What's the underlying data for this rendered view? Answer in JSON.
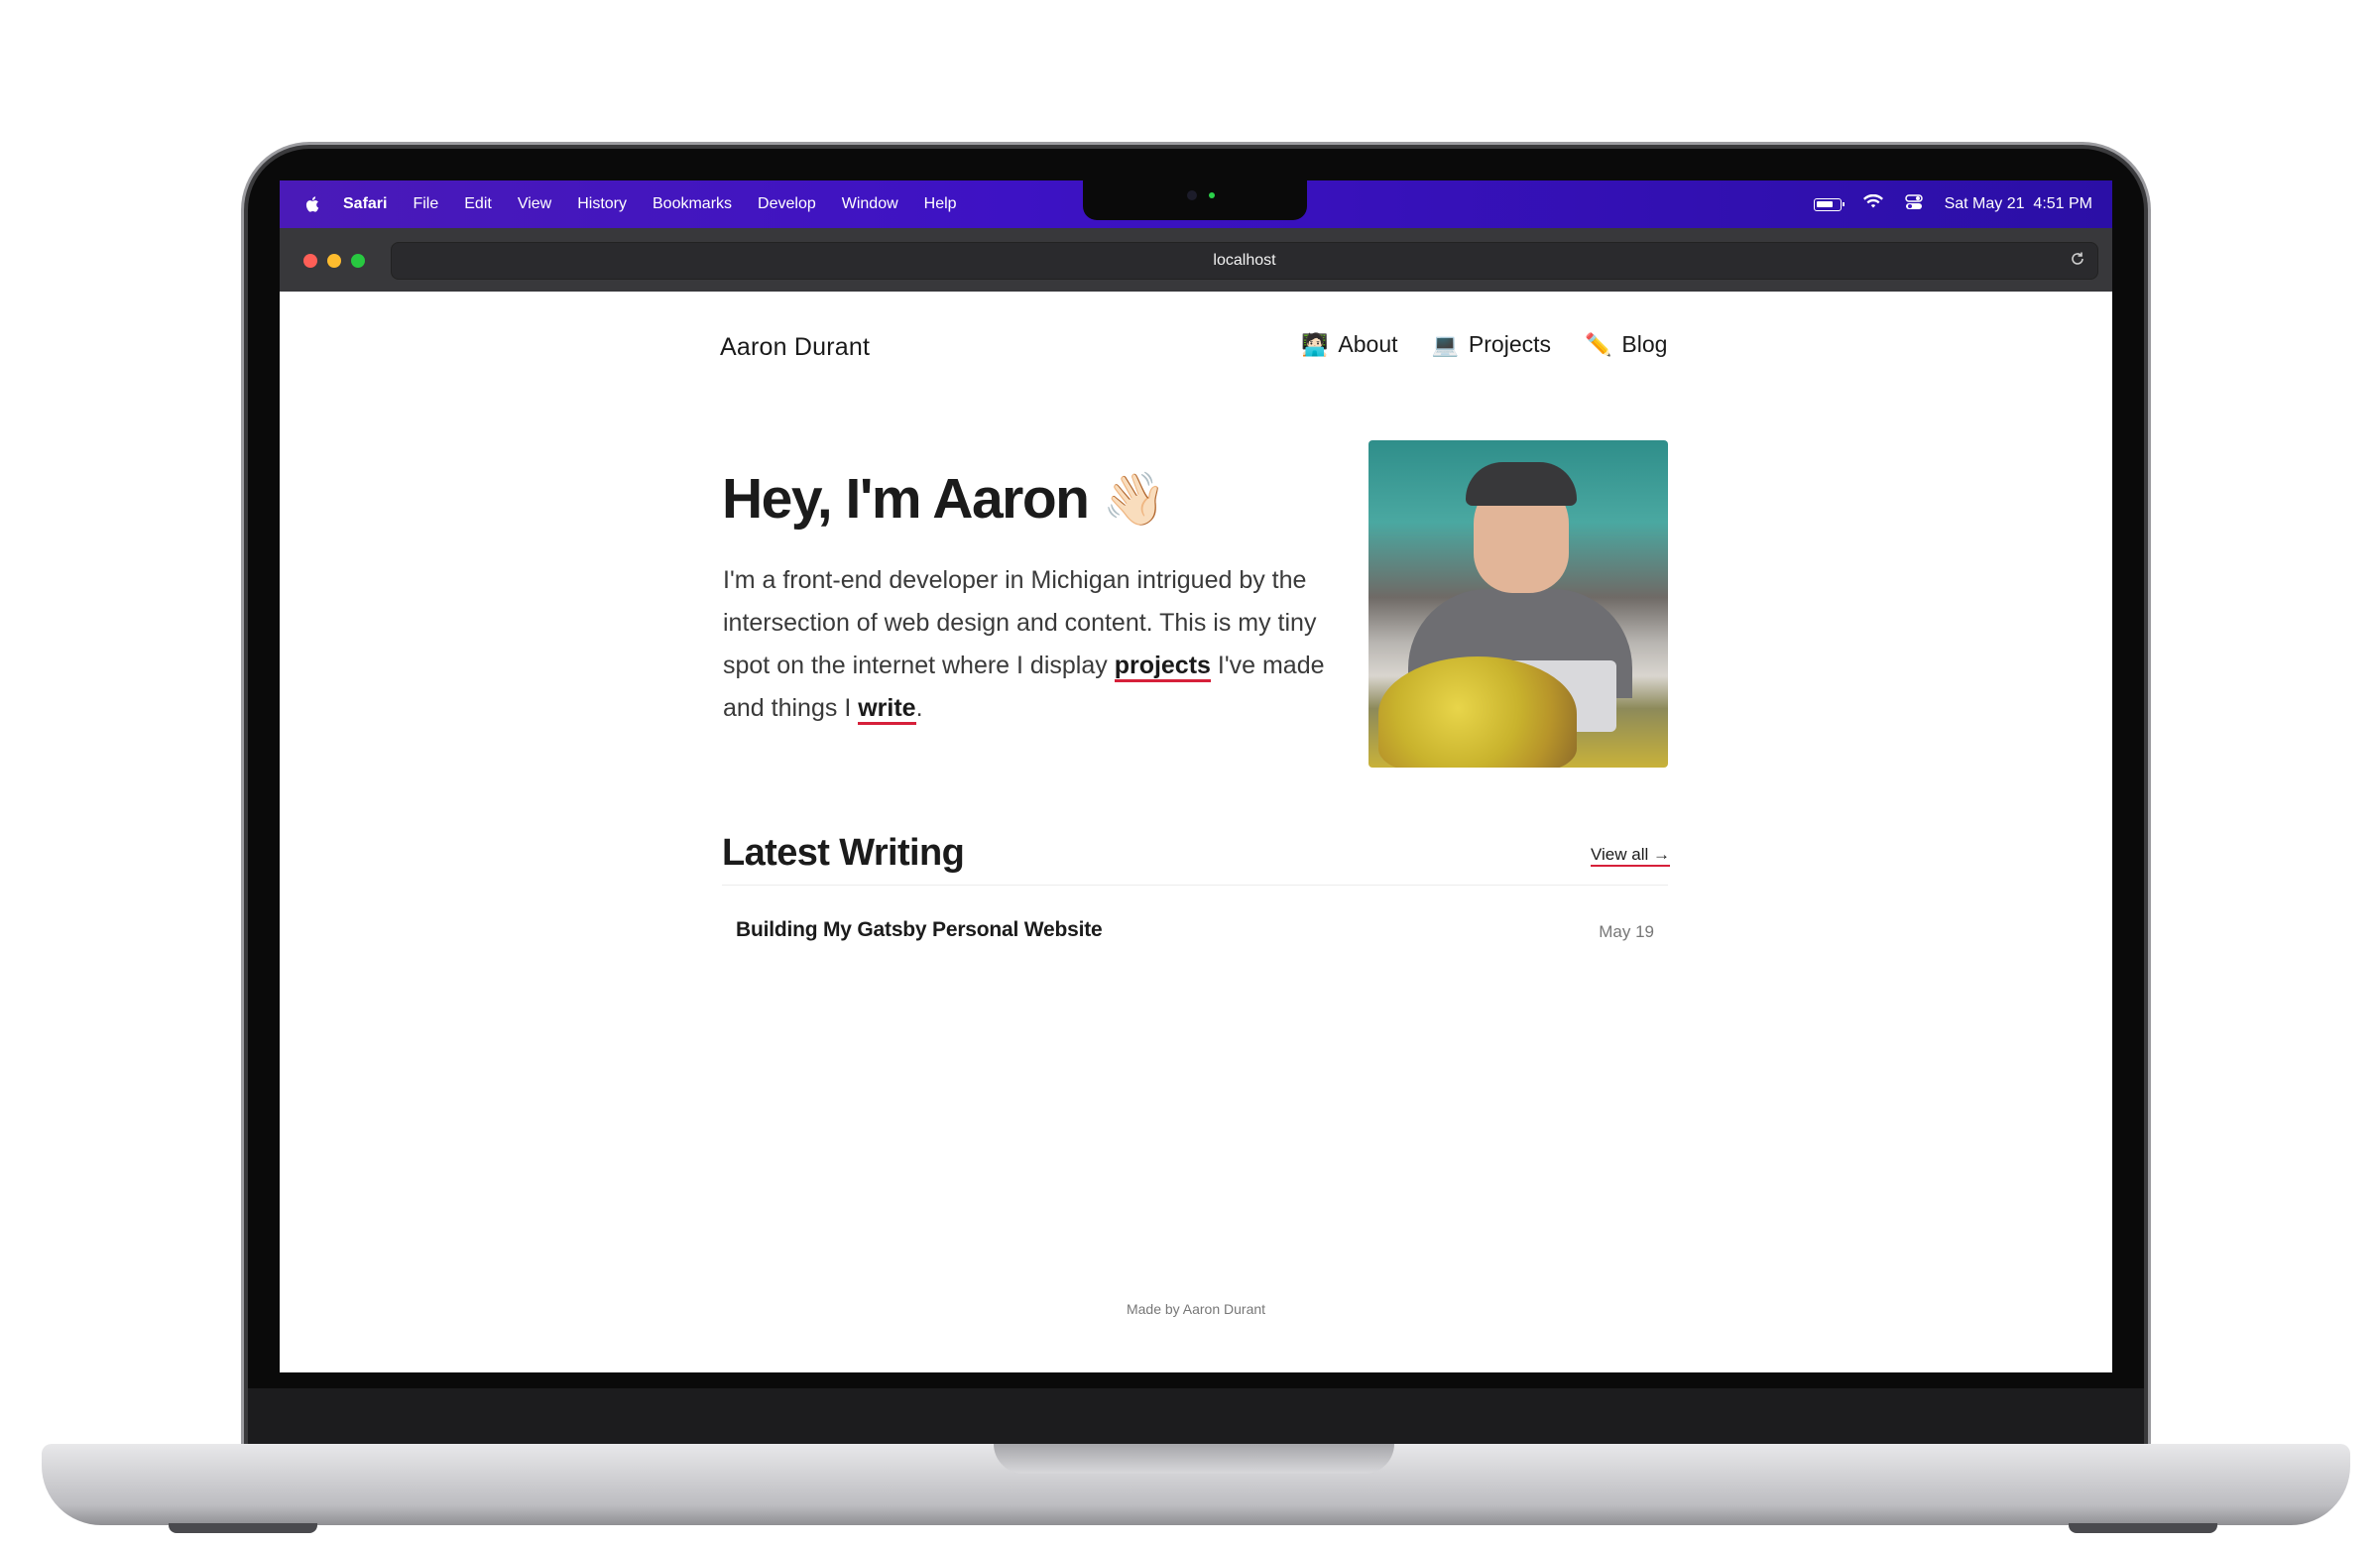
{
  "menubar": {
    "app_name": "Safari",
    "menus": [
      "File",
      "Edit",
      "View",
      "History",
      "Bookmarks",
      "Develop",
      "Window",
      "Help"
    ],
    "clock": "Sat May 21  4:51 PM",
    "status_icons": [
      "apple-icon",
      "battery-icon",
      "wifi-icon",
      "control-center-icon"
    ]
  },
  "browser": {
    "url": "localhost",
    "reload_icon": "reload-icon"
  },
  "site": {
    "name": "Aaron Durant",
    "nav": [
      {
        "emoji": "🧑🏻‍💻",
        "label": "About"
      },
      {
        "emoji": "💻",
        "label": "Projects"
      },
      {
        "emoji": "✏️",
        "label": "Blog"
      }
    ]
  },
  "hero": {
    "title": "Hey, I'm Aaron",
    "wave_emoji": "👋🏻",
    "text_1": "I'm a front-end developer in Michigan intrigued by the intersection of web design and content. This is my tiny spot on the internet where I display ",
    "link_projects": "projects",
    "text_2": " I've made and things I ",
    "link_write": "write",
    "text_3": "."
  },
  "latest": {
    "title": "Latest Writing",
    "view_all": "View all →",
    "posts": [
      {
        "title": "Building My Gatsby Personal Website",
        "date": "May 19"
      }
    ]
  },
  "footer": {
    "text": "Made by Aaron Durant"
  },
  "colors": {
    "menubar_accent": "#3d12c4",
    "link_underline": "#d6203a"
  }
}
